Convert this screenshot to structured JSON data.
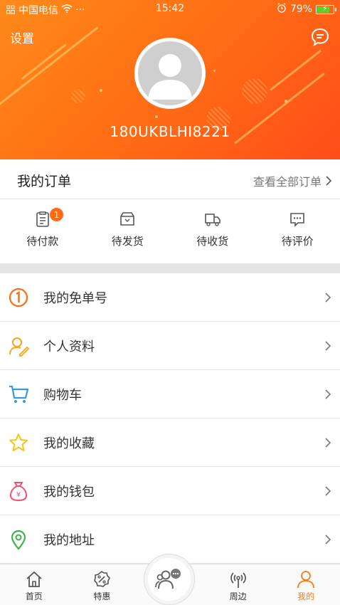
{
  "status_bar": {
    "carrier": "中国电信",
    "signal_prefix": "㗊",
    "dots": "···",
    "time": "15:42",
    "battery": "79%",
    "battery_level": 0.79
  },
  "header": {
    "settings_label": "设置",
    "username": "180UKBLHI8221"
  },
  "orders": {
    "title": "我的订单",
    "view_all": "查看全部订单",
    "items": [
      {
        "label": "待付款",
        "icon": "wallet-list-icon",
        "badge": "1"
      },
      {
        "label": "待发货",
        "icon": "package-box-icon"
      },
      {
        "label": "待收货",
        "icon": "truck-icon"
      },
      {
        "label": "待评价",
        "icon": "comment-icon"
      }
    ]
  },
  "menu": {
    "items": [
      {
        "label": "我的免单号",
        "icon": "circled-one-icon",
        "color": "#ff6a14"
      },
      {
        "label": "个人资料",
        "icon": "user-edit-icon",
        "color": "#f5a623"
      },
      {
        "label": "购物车",
        "icon": "cart-icon",
        "color": "#3a9ad9"
      },
      {
        "label": "我的收藏",
        "icon": "star-icon",
        "color": "#f5c518"
      },
      {
        "label": "我的钱包",
        "icon": "money-bag-icon",
        "color": "#f0506e"
      },
      {
        "label": "我的地址",
        "icon": "location-pin-icon",
        "color": "#3bb54a"
      }
    ]
  },
  "bottom_nav": {
    "items": [
      {
        "label": "首页",
        "icon": "home-icon"
      },
      {
        "label": "特惠",
        "icon": "discount-icon"
      },
      {
        "label": "",
        "icon": "community-icon"
      },
      {
        "label": "周边",
        "icon": "nearby-signal-icon"
      },
      {
        "label": "我的",
        "icon": "profile-icon",
        "active": true
      }
    ]
  },
  "colors": {
    "accent": "#ff6a14",
    "active_tab": "#ff7a14"
  }
}
